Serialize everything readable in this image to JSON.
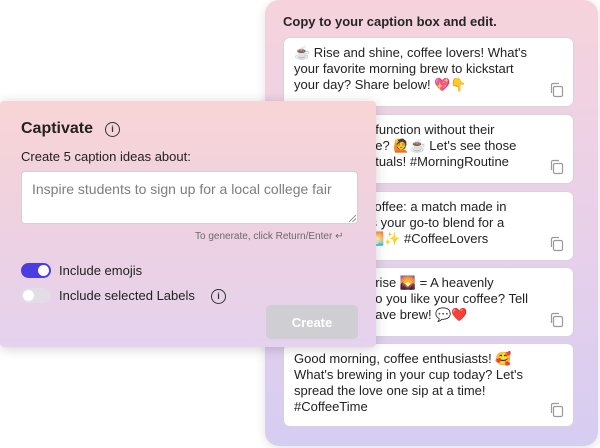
{
  "captions_panel": {
    "header": "Copy to your caption box and edit.",
    "captions": [
      {
        "lines": [
          "☕ Rise and shine, coffee lovers! What's",
          "your favorite morning brew to kickstart",
          "your day? Share below! 💖👇"
        ]
      },
      {
        "lines": [
          "t function without their",
          "ee? 🙋☕ Let's see those",
          "rituals! #MorningRoutine"
        ]
      },
      {
        "lines": [
          "coffee: a match made in",
          "'s your go-to blend for a",
          "🌅✨ #CoffeeLovers"
        ]
      },
      {
        "lines": [
          "nrise 🌄 = A heavenly",
          "do you like your coffee? Tell",
          "have brew! 💬❤️"
        ]
      },
      {
        "lines": [
          "Good morning, coffee enthusiasts! 🥰",
          "What's brewing in your cup today? Let's",
          "spread the love one sip at a time!",
          "#CoffeeTime"
        ]
      }
    ]
  },
  "captivate": {
    "title": "Captivate",
    "prompt_label": "Create 5 caption ideas about:",
    "input_value": "Inspire students to sign up for a local college fair",
    "hint": "To generate, click Return/Enter ↵",
    "options": [
      {
        "label": "Include emojis",
        "enabled": true
      },
      {
        "label": "Include selected Labels",
        "enabled": false
      }
    ],
    "create_label": "Create"
  },
  "colors": {
    "toggle_on": "#4b3ee0",
    "create_disabled": "#cfcfd3"
  }
}
